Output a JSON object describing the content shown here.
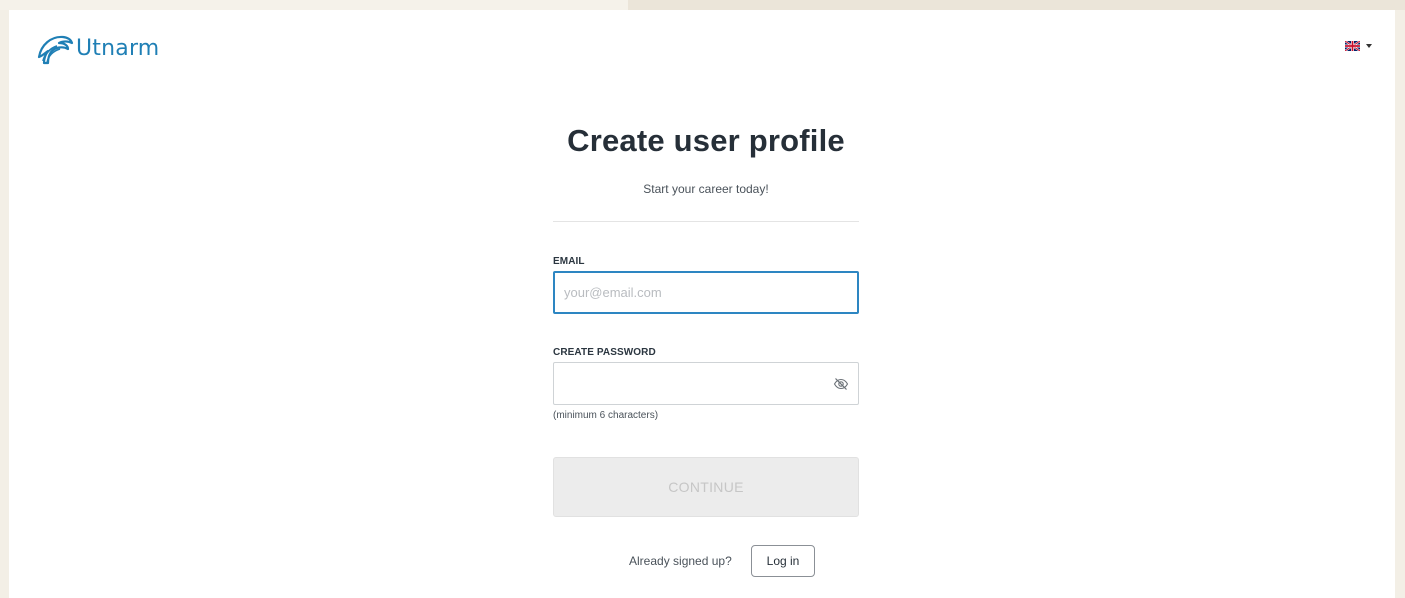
{
  "header": {
    "brand": "Utnarm",
    "language_icon": "uk-flag-icon",
    "dropdown_icon": "caret-down-icon"
  },
  "form": {
    "title": "Create user profile",
    "subtitle": "Start your career today!",
    "email": {
      "label": "EMAIL",
      "placeholder": "your@email.com",
      "value": ""
    },
    "password": {
      "label": "CREATE PASSWORD",
      "value": "",
      "toggle_icon": "eye-slash-icon",
      "hint": "(minimum 6 characters)"
    },
    "continue_label": "CONTINUE",
    "already_text": "Already signed up?",
    "login_label": "Log in"
  },
  "colors": {
    "brand": "#1f7fb5",
    "focus_border": "#2d86c2",
    "disabled_button": "#ececec",
    "disabled_text": "#c6c6c6"
  }
}
